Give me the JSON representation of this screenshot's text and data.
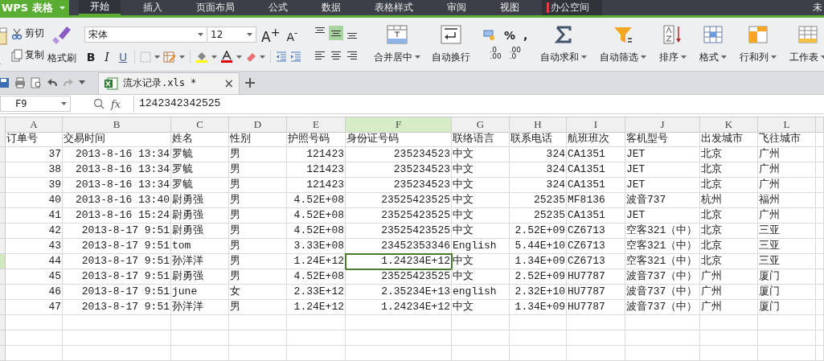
{
  "app_menu": {
    "label": "WPS 表格"
  },
  "menu_tabs": [
    {
      "label": "开始",
      "selected": true,
      "kind": "tab"
    },
    {
      "label": "插入",
      "selected": false,
      "kind": "tab"
    },
    {
      "label": "页面布局",
      "selected": false,
      "kind": "tab"
    },
    {
      "label": "公式",
      "selected": false,
      "kind": "tab"
    },
    {
      "label": "数据",
      "selected": false,
      "kind": "tab"
    },
    {
      "label": "表格样式",
      "selected": false,
      "kind": "tab"
    },
    {
      "label": "审阅",
      "selected": false,
      "kind": "tab"
    },
    {
      "label": "视图",
      "selected": false,
      "kind": "tab"
    },
    {
      "label": "办公空间",
      "selected": false,
      "kind": "space"
    }
  ],
  "account": "未",
  "clipboard": {
    "cut": "剪切",
    "copy": "复制",
    "format_painter": "格式刷"
  },
  "font": {
    "name": "宋体",
    "size": "12",
    "grow": "A$^{+}$",
    "shrink": "A$^{-}$",
    "bold": "B",
    "italic": "I",
    "underline": "U"
  },
  "alignment": [
    {
      "kind": "top",
      "selected": false
    },
    {
      "kind": "middle",
      "selected": true
    },
    {
      "kind": "bottom",
      "selected": false
    },
    {
      "kind": "left",
      "selected": false
    },
    {
      "kind": "center",
      "selected": false
    },
    {
      "kind": "right",
      "selected": false
    }
  ],
  "merge_center": "合并居中",
  "wrap_text": "自动换行",
  "number": {
    "percent": "%",
    "comma": ",",
    "add_decimal": {
      "top": ".0",
      "bottom": ".00"
    },
    "remove_decimal": {
      "top": ".00",
      "bottom": ".0"
    }
  },
  "tools": [
    {
      "kind": "sum",
      "label": "自动求和"
    },
    {
      "kind": "filter",
      "label": "自动筛选"
    },
    {
      "kind": "sort",
      "label": "排序"
    },
    {
      "kind": "format",
      "label": "格式"
    },
    {
      "kind": "rowcol",
      "label": "行和列"
    },
    {
      "kind": "sheet",
      "label": "工作表"
    }
  ],
  "document_tab": {
    "title": "流水记录.xls *",
    "close": "×"
  },
  "formula_bar": {
    "name_box": "F9",
    "fx": "fx",
    "value": "1242342342525"
  },
  "sheet": {
    "columns": [
      {
        "letter": "A",
        "kind": "number",
        "selected": false
      },
      {
        "letter": "B",
        "kind": "number",
        "selected": false
      },
      {
        "letter": "C",
        "kind": "text",
        "selected": false
      },
      {
        "letter": "D",
        "kind": "text",
        "selected": false
      },
      {
        "letter": "E",
        "kind": "number",
        "selected": false
      },
      {
        "letter": "F",
        "kind": "number",
        "selected": true
      },
      {
        "letter": "G",
        "kind": "text",
        "selected": false
      },
      {
        "letter": "H",
        "kind": "number",
        "selected": false
      },
      {
        "letter": "I",
        "kind": "text",
        "selected": false
      },
      {
        "letter": "J",
        "kind": "text",
        "selected": false
      },
      {
        "letter": "K",
        "kind": "text",
        "selected": false
      },
      {
        "letter": "L",
        "kind": "text",
        "selected": false
      },
      {
        "kind": "text",
        "selected": false
      }
    ],
    "header": [
      "订单号",
      "交易时间",
      "姓名",
      "性别",
      "护照号码",
      "身份证号码",
      "联络语言",
      "联系电话",
      "航班班次",
      "客机型号",
      "出发城市",
      "飞往城市"
    ],
    "rows": [
      {
        "selected": false,
        "cells": [
          "37",
          "2013-8-16 13:34",
          "罗毓",
          "男",
          "121423",
          "235234523",
          "中文",
          "324",
          "CA1351",
          "JET",
          "北京",
          "广州"
        ]
      },
      {
        "selected": false,
        "cells": [
          "38",
          "2013-8-16 13:34",
          "罗毓",
          "男",
          "121423",
          "235234523",
          "中文",
          "324",
          "CA1351",
          "JET",
          "北京",
          "广州"
        ]
      },
      {
        "selected": false,
        "cells": [
          "39",
          "2013-8-16 13:34",
          "罗毓",
          "男",
          "121423",
          "235234523",
          "中文",
          "324",
          "CA1351",
          "JET",
          "北京",
          "广州"
        ]
      },
      {
        "selected": false,
        "cells": [
          "40",
          "2013-8-16 13:40",
          "尉勇强",
          "男",
          "4.52E+08",
          "23525423525",
          "中文",
          "25235",
          "MF8136",
          "波音737",
          "杭州",
          "福州"
        ]
      },
      {
        "selected": false,
        "cells": [
          "41",
          "2013-8-16 15:24",
          "尉勇强",
          "男",
          "4.52E+08",
          "23525423525",
          "中文",
          "25235",
          "CA1351",
          "JET",
          "北京",
          "广州"
        ]
      },
      {
        "selected": false,
        "cells": [
          "42",
          "2013-8-17 9:51",
          "尉勇强",
          "男",
          "4.52E+08",
          "23525423525",
          "中文",
          "2.52E+09",
          "CZ6713",
          "空客321（中）",
          "北京",
          "三亚"
        ]
      },
      {
        "selected": false,
        "cells": [
          "43",
          "2013-8-17 9:51",
          "tom",
          "男",
          "3.33E+08",
          "23452353346",
          "English",
          "5.44E+10",
          "CZ6713",
          "空客321（中）",
          "北京",
          "三亚"
        ]
      },
      {
        "selected": true,
        "cells": [
          "44",
          "2013-8-17 9:51",
          "孙洋洋",
          "男",
          "1.24E+12",
          "1.24234E+12",
          "中文",
          "1.34E+09",
          "CZ6713",
          "空客321（中）",
          "北京",
          "三亚"
        ]
      },
      {
        "selected": false,
        "cells": [
          "45",
          "2013-8-17 9:51",
          "尉勇强",
          "男",
          "4.52E+08",
          "23525423525",
          "中文",
          "2.52E+09",
          "HU7787",
          "波音737（中）",
          "广州",
          "厦门"
        ]
      },
      {
        "selected": false,
        "cells": [
          "46",
          "2013-8-17 9:51",
          "june",
          "女",
          "2.33E+12",
          "2.35234E+13",
          "english",
          "2.32E+10",
          "HU7787",
          "波音737（中）",
          "广州",
          "厦门"
        ]
      },
      {
        "selected": false,
        "cells": [
          "47",
          "2013-8-17 9:51",
          "孙洋洋",
          "男",
          "1.24E+12",
          "1.24234E+12",
          "中文",
          "1.34E+09",
          "HU7787",
          "波音737（中）",
          "广州",
          "厦门"
        ]
      }
    ]
  }
}
